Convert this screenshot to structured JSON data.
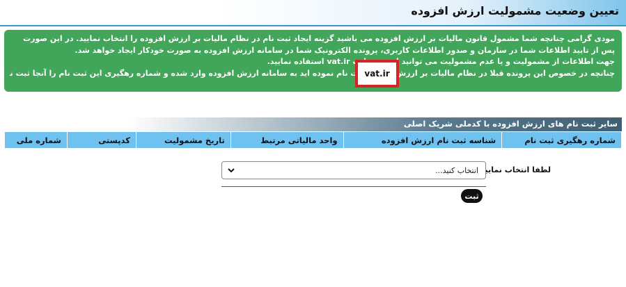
{
  "header": {
    "title": "تعیین وضعیت مشمولیت ارزش افزوده"
  },
  "notice": {
    "line1": "مودی گرامی چنانچه شما مشمول قانون مالیات بر ارزش افزوده می باشید گزینه ایجاد ثبت نام در نظام مالیات بر ارزش افزوده را انتخاب نمایید. در این صورت پس از تایید اطلاعات شما در سازمان و صدور اطلاعات کاربری، پرونده الکترونیک شما در سامانه ارزش افزوده به صورت خودکار ایجاد خواهد شد.",
    "line2": "جهت اطلاعات از مشمولیت و یا عدم مشمولیت می توانید از وب سایت vat.ir استفاده نمایید.",
    "line3": "چنانچه در خصوص این پرونده قبلا در نظام مالیات بر ارزش افزوده ثبت نام نموده اید به سامانه ارزش افزوده وارد شده و شماره رهگیری این ثبت نام را آنجا ثبت نمایید.",
    "highlight_text": "vat.ir"
  },
  "section": {
    "title": "سایر ثبت نام های ارزش افزوده با کدملی شریک اصلی"
  },
  "table": {
    "columns": [
      "شماره رهگیری ثبت نام",
      "شناسه ثبت نام ارزش افزوده",
      "واحد مالیاتی مرتبط",
      "تاریخ مشمولیت",
      "کدپستی",
      "شماره ملی"
    ]
  },
  "form": {
    "label": "لطفا انتخاب نمایید:",
    "select_value": "انتخاب کنید...",
    "submit_label": "ثبت"
  },
  "colors": {
    "notice_bg": "#41a65a",
    "table_header_bg": "#6fc2f0",
    "highlight_border": "#d72323"
  }
}
